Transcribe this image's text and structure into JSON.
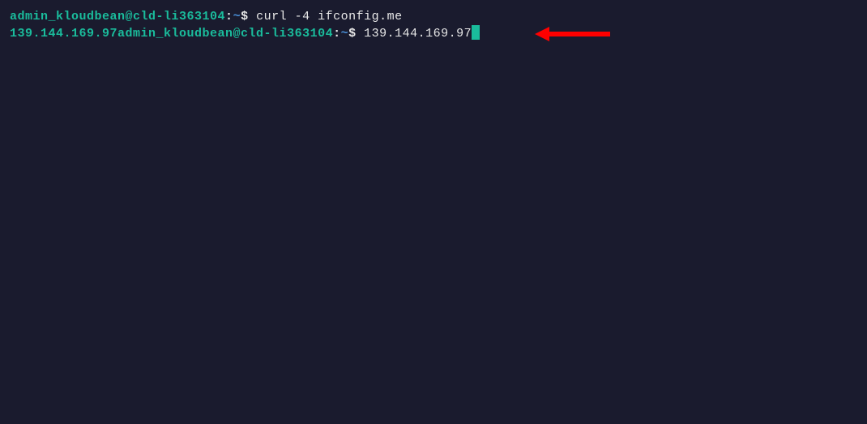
{
  "line1": {
    "user_host": "admin_kloudbean@cld-li363104",
    "sep1": ":",
    "path": "~",
    "dollar": "$ ",
    "command": "curl -4 ifconfig.me"
  },
  "line2": {
    "output": "139.144.169.97",
    "user_host": "admin_kloudbean@cld-li363104",
    "sep1": ":",
    "path": "~",
    "dollar": "$ ",
    "typed": "139.144.169.97"
  }
}
